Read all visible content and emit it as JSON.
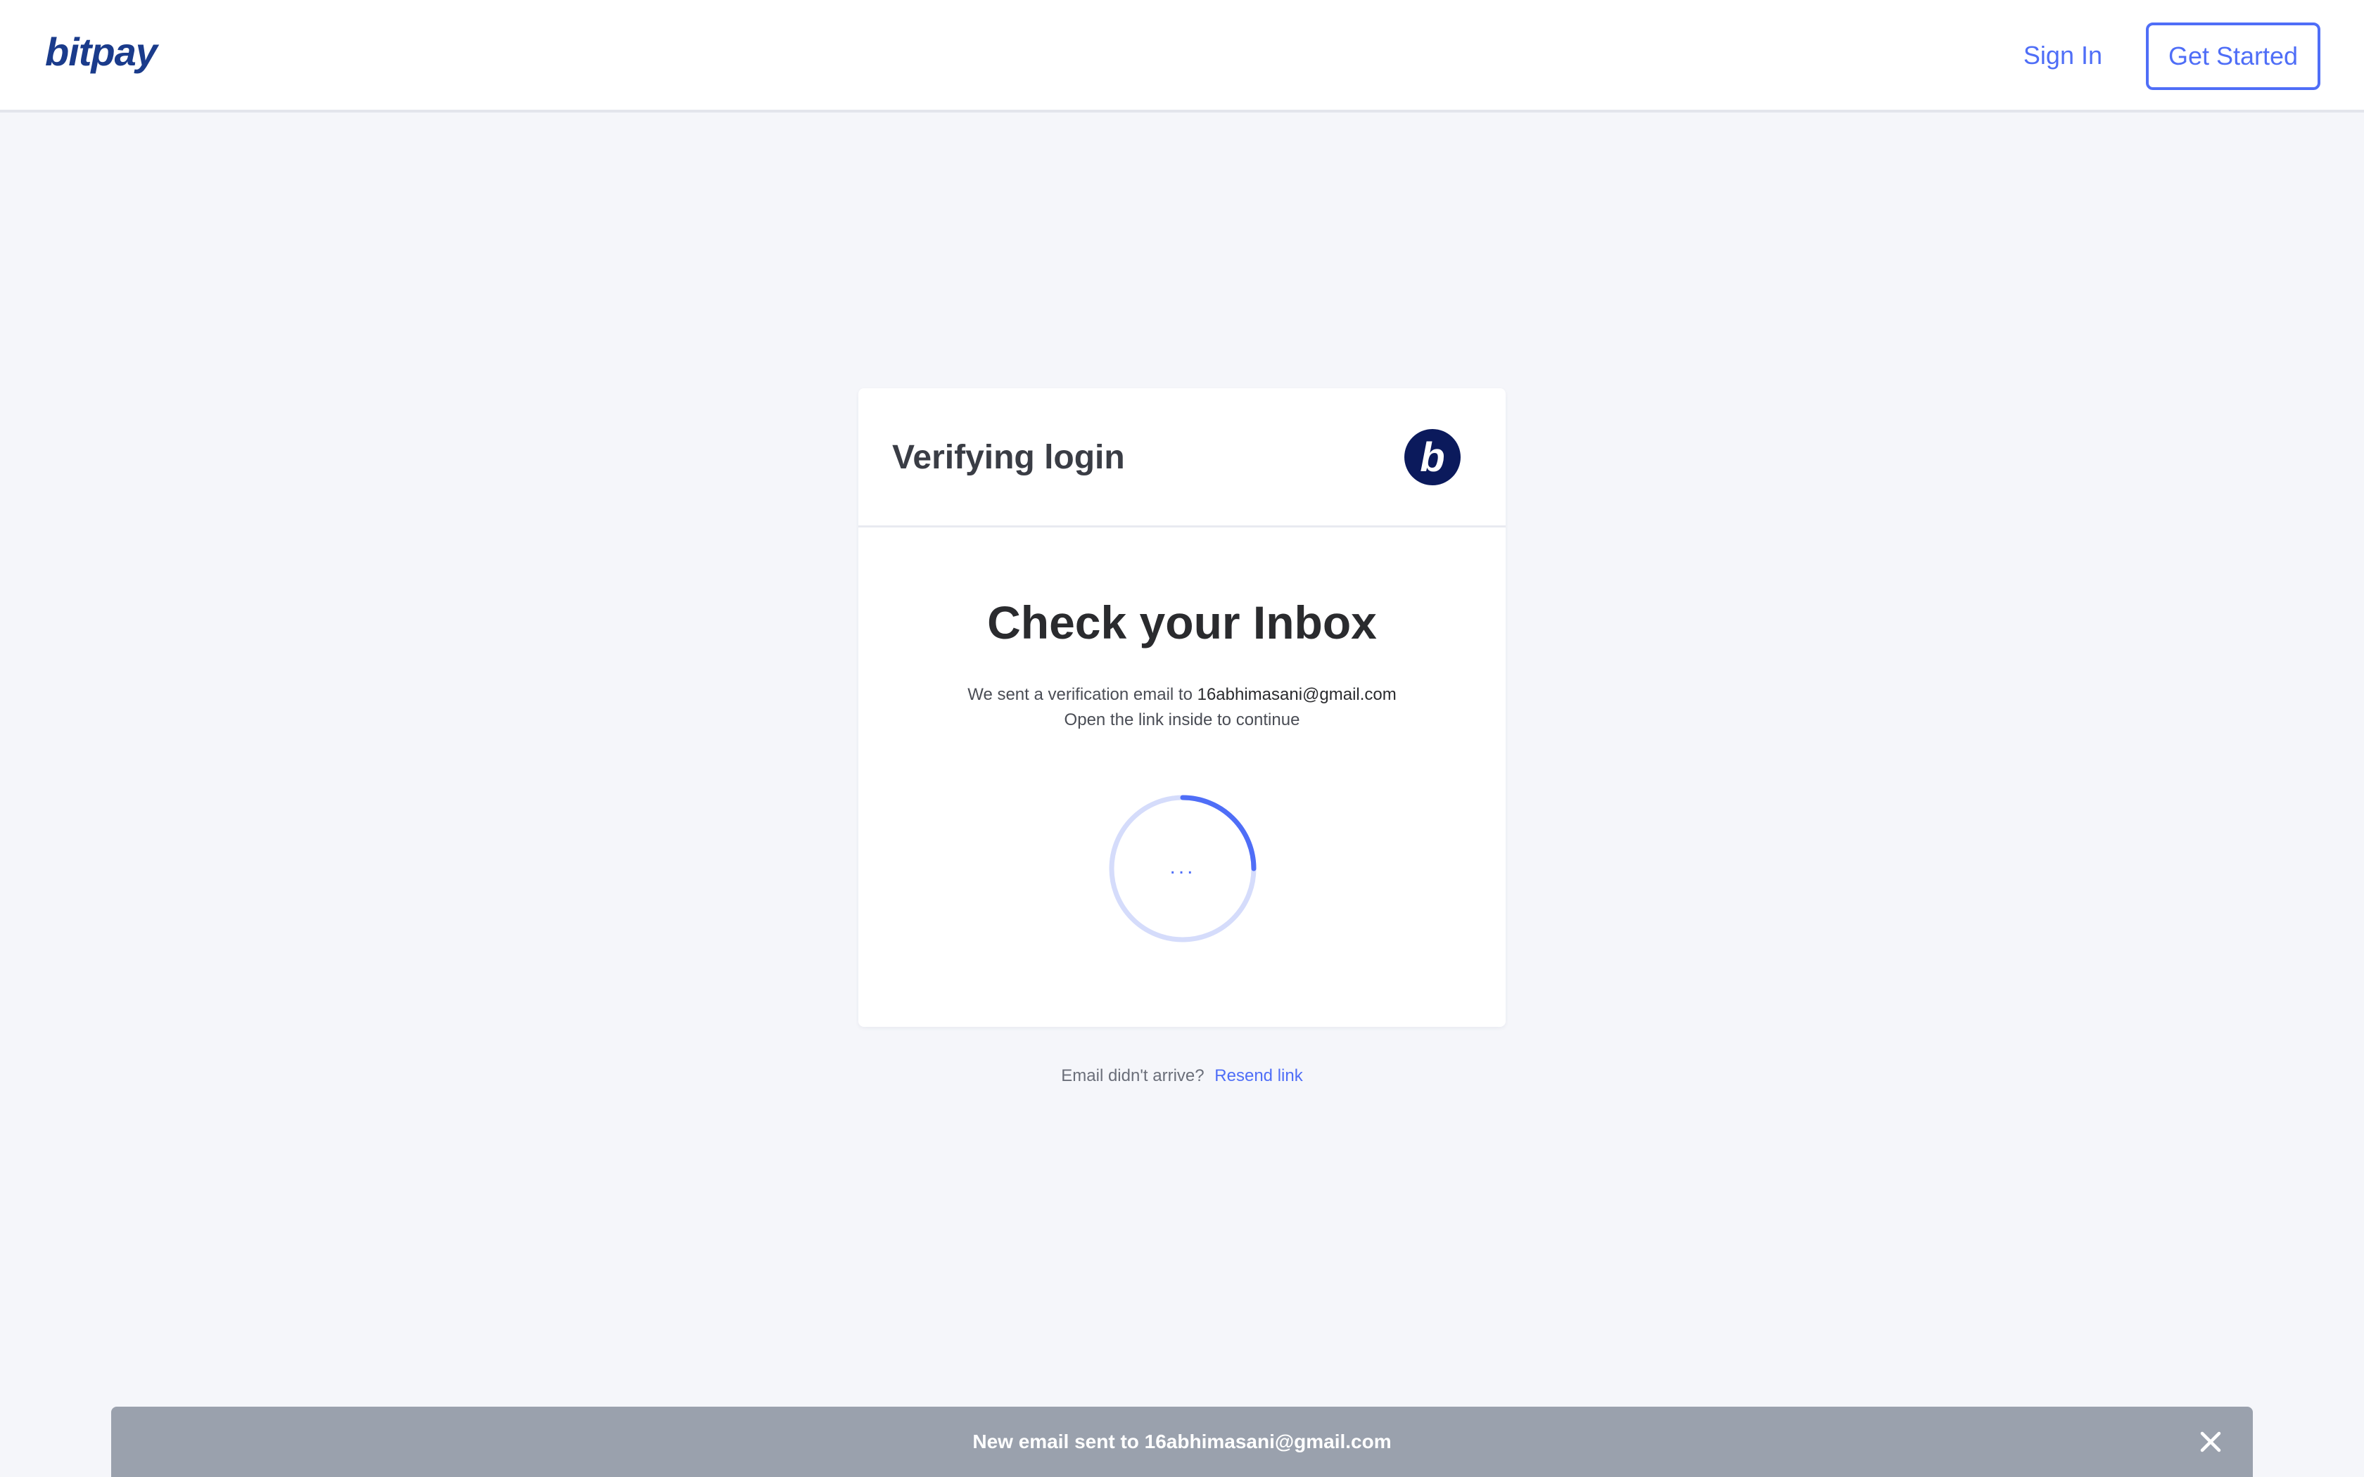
{
  "header": {
    "logo_text": "bitpay",
    "signin_label": "Sign In",
    "get_started_label": "Get Started"
  },
  "card": {
    "title": "Verifying login",
    "badge_letter": "b",
    "heading": "Check your Inbox",
    "sent_prefix": "We sent a verification email to",
    "email": "16abhimasani@gmail.com",
    "instruction": "Open the link inside to continue",
    "spinner_text": "..."
  },
  "resend": {
    "prompt": "Email didn't arrive?",
    "link_label": "Resend link"
  },
  "toast": {
    "message": "New email sent to 16abhimasani@gmail.com"
  },
  "colors": {
    "accent": "#4f6ef7",
    "brand": "#1a3b8b",
    "badge": "#0b1a5c",
    "background": "#f5f6fa",
    "toast": "#9aa1ad"
  },
  "icons": {
    "brand_badge": "bitpay-b-icon",
    "spinner": "loading-spinner-icon",
    "toast_close": "close-icon"
  }
}
